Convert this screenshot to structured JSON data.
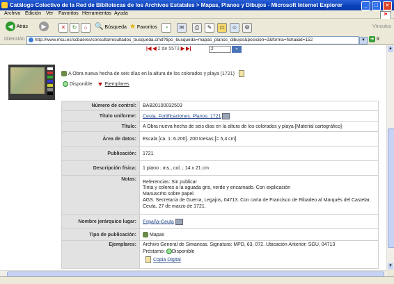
{
  "window": {
    "title": "Catálogo Colectivo de la Red de Bibliotecas de los Archivos Estatales > Mapas, Planos y Dibujos - Microsoft Internet Explorer",
    "min_label": "_",
    "max_label": "□",
    "close_label": "×"
  },
  "menu": [
    "Archivo",
    "Edición",
    "Ver",
    "Favoritos",
    "Herramientas",
    "Ayuda"
  ],
  "toolbar": {
    "back_label": "Atrás",
    "search_label": "Búsqueda",
    "favorites_label": "Favoritos",
    "links_label": "Vínculos"
  },
  "address": {
    "label": "Dirección",
    "url": "http://www.mcu.es/ccbae/es/consulta/resultados_busqueda.cmd?tipo_busqueda=mapas_planos_dibujos&posicion=2&forma=ficha&id=152",
    "go_label": "Ir"
  },
  "pager": {
    "position_text": "2 de 5573",
    "input_value": "2"
  },
  "record": {
    "title": "A Obra nueva hecha de seis días en la altura de los colorados y playa (1721)",
    "availability": "Disponible",
    "copies_link": "Ejemplares"
  },
  "fields": {
    "numero_label": "Número de control:",
    "numero_value": "BAB20100032503",
    "titulo_uniforme_label": "Título uniforme:",
    "titulo_uniforme_value": "Ceuta. Fortificaciones. Planos. 1721",
    "titulo_label": "Título:",
    "titulo_value": "A Obra nueva hecha de seis días en la altura de los colorados y playa [Material cartográfico]",
    "area_label": "Área de datos:",
    "area_value": "Escala [ca. 1: 6.200]. 200 toesas [= 5,4 cm]",
    "publicacion_label": "Publicación:",
    "publicacion_value": "1721",
    "descripcion_label": "Descripción física:",
    "descripcion_value": "1 plano : ms., col. ; 14 x 21 cm",
    "notas_label": "Notas:",
    "notas_lines": [
      "Referencias: Sin publicar",
      "Tinta y colores a la aguada gris, verde y encarnado. Con explicación",
      "Manuscrito sobre papel.",
      "AGS. Secretaría de Guerra, Legajos, 04713. Con carta de Francisco de Ribadeo al Marqués del Castelar,",
      "Ceuta, 27 de marzo de 1721."
    ],
    "nombre_label": "Nombre jerárquico lugar:",
    "nombre_value": "España-Ceuta",
    "tipo_label": "Tipo de publicación:",
    "tipo_value": "Mapas",
    "ejemplares_label": "Ejemplares:",
    "ejemplares_value": "Archivo General de Simancas. Signatura: MPD, 63, 072. Ubicación Anterior: SGU, 04713",
    "prestamo_label": "Préstamo:",
    "prestamo_value": "Disponible",
    "copia_label": "Copia Digital"
  }
}
